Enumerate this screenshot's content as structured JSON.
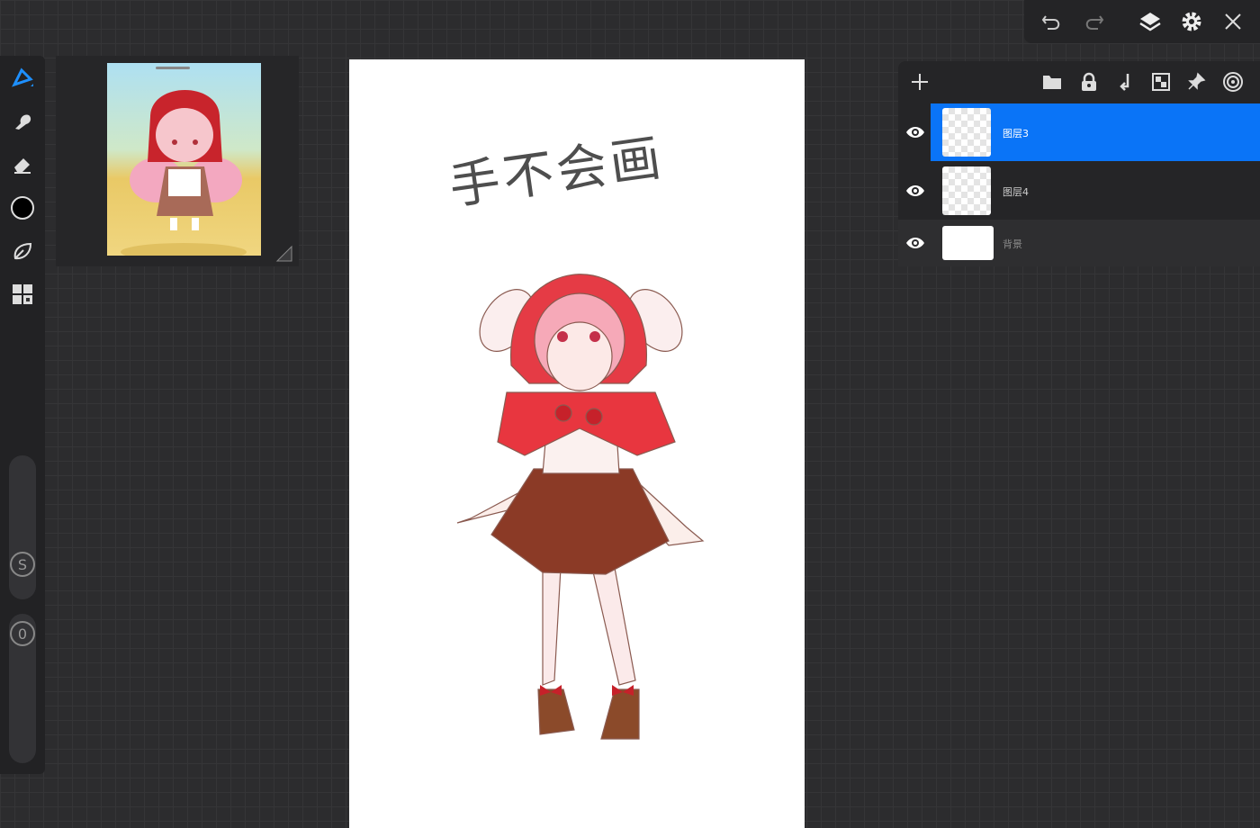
{
  "canvas": {
    "handwriting": "手不会画"
  },
  "left_toolbar": {
    "tools": [
      "brush-tool",
      "smudge-tool",
      "eraser-tool",
      "color-picker",
      "liquify-tool",
      "gallery-tool"
    ],
    "size_label": "S",
    "opacity_label": "0",
    "current_color": "#000000"
  },
  "top_bar": {
    "buttons": [
      "undo",
      "redo",
      "layers",
      "settings",
      "close"
    ]
  },
  "layers_panel": {
    "accent": "#0a74f7",
    "layers": [
      {
        "name": "图层3",
        "selected": true,
        "visible": true
      },
      {
        "name": "图层4",
        "selected": false,
        "visible": true
      },
      {
        "name": "背景",
        "selected": false,
        "visible": true
      }
    ]
  }
}
